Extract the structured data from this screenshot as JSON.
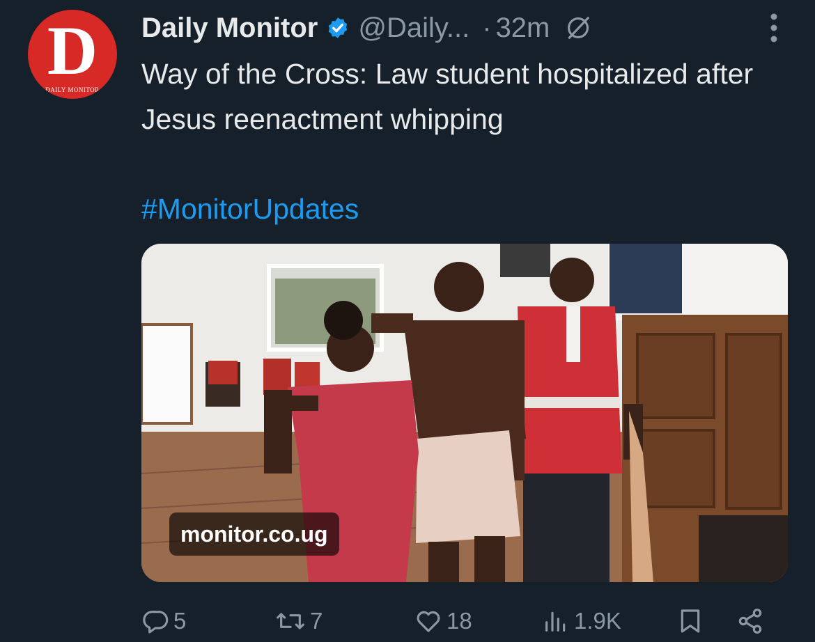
{
  "account": {
    "avatar_letter": "D",
    "avatar_caption": "DAILY MONITOR",
    "display_name": "Daily Monitor",
    "handle": "@Daily...",
    "separator": "·",
    "time": "32m",
    "verified": true
  },
  "tweet": {
    "text": "Way of the Cross: Law student hospitalized after Jesus reenactment whipping",
    "hashtag": "#MonitorUpdates"
  },
  "media": {
    "domain_label": "monitor.co.ug"
  },
  "actions": {
    "replies": "5",
    "reposts": "7",
    "likes": "18",
    "views": "1.9K"
  },
  "colors": {
    "background": "#15202b",
    "text": "#e7e9ea",
    "muted": "#8b98a5",
    "link": "#1d9bf0",
    "verified_badge": "#1d9bf0",
    "avatar_red": "#d72a26"
  },
  "icons": [
    "verified-icon",
    "grok-icon",
    "more-icon",
    "reply-icon",
    "repost-icon",
    "like-icon",
    "views-icon",
    "bookmark-icon",
    "share-icon"
  ]
}
